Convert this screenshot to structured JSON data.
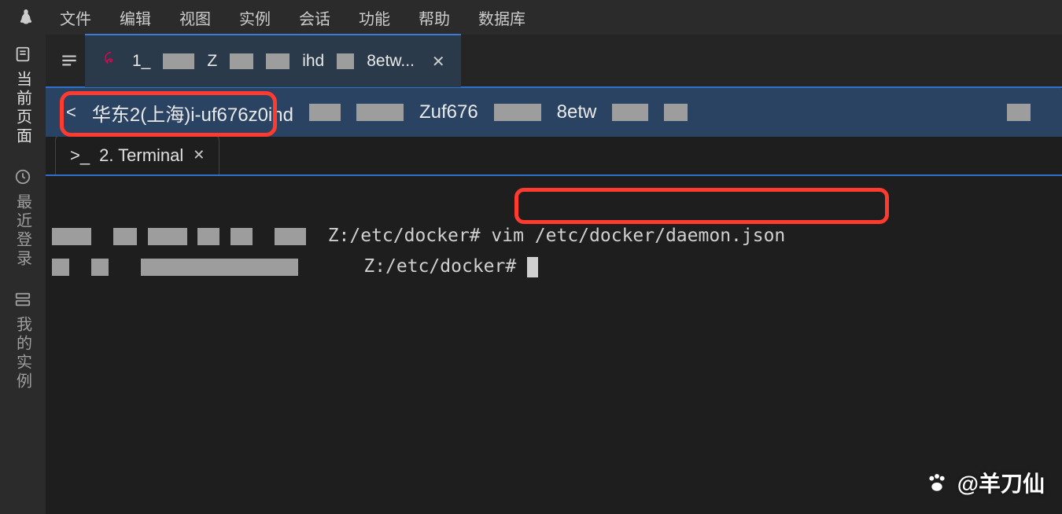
{
  "menubar": {
    "items": [
      "文件",
      "编辑",
      "视图",
      "实例",
      "会话",
      "功能",
      "帮助",
      "数据库"
    ]
  },
  "sidebar": {
    "tabs": [
      {
        "label": "当前页面",
        "icon": "page"
      },
      {
        "label": "最近登录",
        "icon": "clock"
      },
      {
        "label": "我的实例",
        "icon": "server"
      }
    ]
  },
  "tabs": {
    "active": {
      "parts": [
        "1_",
        "Z",
        "ihd",
        "8etw..."
      ]
    }
  },
  "breadcrumb": {
    "text": "华东2(上海)i-uf676z0ihd",
    "frag1": "Zuf676",
    "frag2": "8etw"
  },
  "terminal_tab": {
    "label": "2. Terminal"
  },
  "terminal": {
    "line1_mid": "Z:/etc/docker# ",
    "line1_cmd": "vim /etc/docker/daemon.json",
    "line2_mid": "Z:/etc/docker# "
  },
  "watermark": "@羊刀仙"
}
